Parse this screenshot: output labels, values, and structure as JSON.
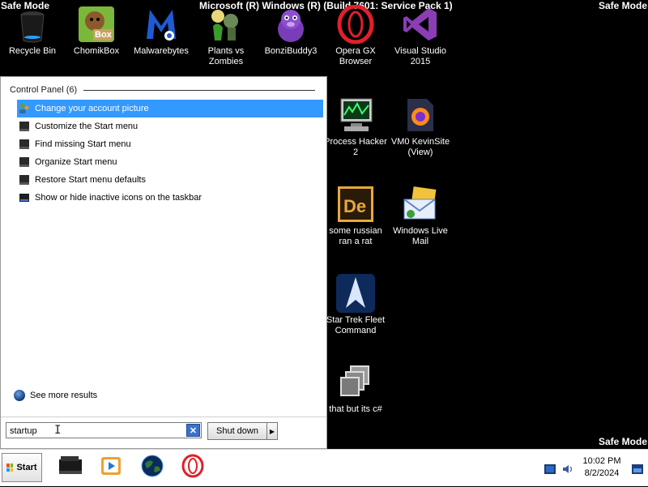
{
  "desktop": {
    "banner_center": "Microsoft (R) Windows (R) (Build 7601: Service Pack 1)",
    "banner_top_left": "Safe Mode",
    "banner_top_right": "Safe Mode",
    "banner_bottom_right": "Safe Mode",
    "icons": [
      {
        "label": "Recycle Bin",
        "icon": "recycle-bin-icon"
      },
      {
        "label": "ChomikBox",
        "icon": "chomikbox-icon"
      },
      {
        "label": "Malwarebytes",
        "icon": "malwarebytes-icon"
      },
      {
        "label": "Plants vs Zombies",
        "icon": "plants-vs-zombies-icon"
      },
      {
        "label": "BonziBuddy3",
        "icon": "bonzibuddy-icon"
      },
      {
        "label": "Opera GX Browser",
        "icon": "opera-gx-icon"
      },
      {
        "label": "Visual Studio 2015",
        "icon": "visual-studio-icon"
      },
      {
        "label": "Process Hacker 2",
        "icon": "process-hacker-icon"
      },
      {
        "label": "VM0 KevinSite (View)",
        "icon": "firefox-file-icon"
      },
      {
        "label": "some russian ran a rat",
        "icon": "dreamweaver-icon"
      },
      {
        "label": "Windows Live Mail",
        "icon": "windows-live-mail-icon"
      },
      {
        "label": "Star Trek Fleet Command",
        "icon": "star-trek-icon"
      },
      {
        "label": "that but its c#",
        "icon": "copy-files-icon"
      }
    ],
    "chomikbox_badge": "Box"
  },
  "start_menu": {
    "group_header": "Control Panel (6)",
    "results": [
      {
        "label": "Change your account picture",
        "selected": true
      },
      {
        "label": "Customize the Start menu",
        "selected": false
      },
      {
        "label": "Find missing Start menu",
        "selected": false
      },
      {
        "label": "Organize Start menu",
        "selected": false
      },
      {
        "label": "Restore Start menu defaults",
        "selected": false
      },
      {
        "label": "Show or hide inactive icons on the taskbar",
        "selected": false
      }
    ],
    "see_more": "See more results",
    "search_value": "startup",
    "clear_symbol": "✕",
    "shutdown_label": "Shut down",
    "shutdown_arrow": "▶"
  },
  "taskbar": {
    "start_label": "Start",
    "pinned": [
      "file-explorer-icon",
      "media-player-icon",
      "earth-globe-icon",
      "opera-icon"
    ],
    "clock_time": "10:02 PM",
    "clock_date": "8/2/2024"
  },
  "colors": {
    "selection": "#3399ff",
    "desktop_bg": "#000000",
    "opera_red": "#e0202a",
    "vs_purple": "#68217a"
  }
}
